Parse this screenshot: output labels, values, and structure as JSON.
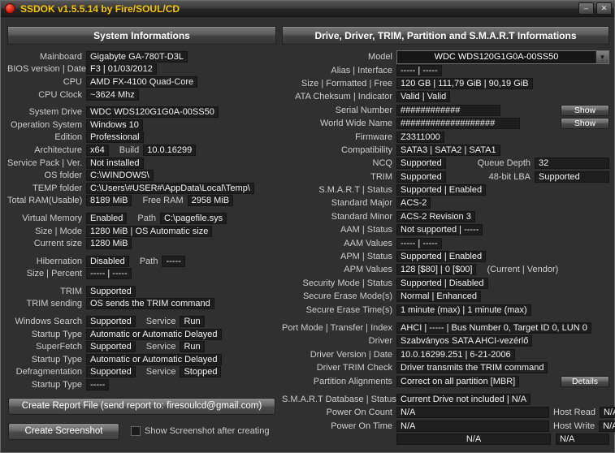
{
  "window": {
    "title": "SSDOK v1.5.5.14 by Fire/SOUL/CD",
    "minimize_icon": "–",
    "close_icon": "✕"
  },
  "left": {
    "header": "System Informations",
    "rows": [
      {
        "label": "Mainboard",
        "value": "Gigabyte GA-780T-D3L"
      },
      {
        "label": "BIOS version | Date",
        "value": "F3  |  01/03/2012"
      },
      {
        "label": "CPU",
        "value": "AMD FX-4100 Quad-Core"
      },
      {
        "label": "CPU Clock",
        "value": "~3624 Mhz"
      },
      {
        "label": "System Drive",
        "value": "WDC WDS120G1G0A-00SS50"
      },
      {
        "label": "Operation System",
        "value": "Windows 10"
      },
      {
        "label": "Edition",
        "value": "Professional"
      },
      {
        "label": "Architecture",
        "value": "x64",
        "label2": "Build",
        "value2": "10.0.16299"
      },
      {
        "label": "Service Pack | Ver.",
        "value": "Not installed"
      },
      {
        "label": "OS folder",
        "value": "C:\\WINDOWS\\"
      },
      {
        "label": "TEMP folder",
        "value": "C:\\Users\\#USER#\\AppData\\Local\\Temp\\"
      },
      {
        "label": "Total RAM(Usable)",
        "value": "8189 MiB",
        "label2": "Free RAM",
        "value2": "2958 MiB"
      },
      {
        "label": "Virtual Memory",
        "value": "Enabled",
        "label2": "Path",
        "value2": "C:\\pagefile.sys"
      },
      {
        "label": "Size | Mode",
        "value": "1280 MiB  |  OS Automatic size"
      },
      {
        "label": "Current size",
        "value": "1280 MiB"
      },
      {
        "label": "Hibernation",
        "value": "Disabled",
        "label2": "Path",
        "value2": "-----"
      },
      {
        "label": "Size | Percent",
        "value": "-----  |  -----"
      },
      {
        "label": "TRIM",
        "value": "Supported"
      },
      {
        "label": "TRIM sending",
        "value": "OS sends the TRIM command"
      },
      {
        "label": "Windows Search",
        "value": "Supported",
        "label2": "Service",
        "value2": "Run"
      },
      {
        "label": "Startup Type",
        "value": "Automatic or Automatic Delayed"
      },
      {
        "label": "SuperFetch",
        "value": "Supported",
        "label2": "Service",
        "value2": "Run"
      },
      {
        "label": "Startup Type",
        "value": "Automatic or Automatic Delayed"
      },
      {
        "label": "Defragmentation",
        "value": "Supported",
        "label2": "Service",
        "value2": "Stopped"
      },
      {
        "label": "Startup Type",
        "value": "-----"
      }
    ],
    "report_button": "Create Report File (send report to: firesoulcd@gmail.com)",
    "screenshot_button": "Create Screenshot",
    "screenshot_checkbox": "Show Screenshot after creating"
  },
  "right": {
    "header": "Drive, Driver, TRIM, Partition and S.M.A.R.T Informations",
    "rows": [
      {
        "label": "Model",
        "value": "WDC WDS120G1G0A-00SS50"
      },
      {
        "label": "Alias | Interface",
        "value": "-----  |  -----"
      },
      {
        "label": "Size | Formatted | Free",
        "value": "120 GB  |  111,79 GiB  |  90,19 GiB"
      },
      {
        "label": "ATA Cheksum | Indicator",
        "value": "Valid  |  Valid"
      },
      {
        "label": "Serial Number",
        "value": "############",
        "button": "Show"
      },
      {
        "label": "World Wide Name",
        "value": "###################",
        "button": "Show"
      },
      {
        "label": "Firmware",
        "value": "Z3311000"
      },
      {
        "label": "Compatibility",
        "value": "SATA3 | SATA2 | SATA1"
      },
      {
        "label": "NCQ",
        "value": "Supported",
        "label2": "Queue Depth",
        "value2": "32"
      },
      {
        "label": "TRIM",
        "value": "Supported",
        "label2": "48-bit LBA",
        "value2": "Supported"
      },
      {
        "label": "S.M.A.R.T | Status",
        "value": "Supported  |  Enabled"
      },
      {
        "label": "Standard Major",
        "value": "ACS-2"
      },
      {
        "label": "Standard Minor",
        "value": "ACS-2 Revision 3"
      },
      {
        "label": "AAM | Status",
        "value": "Not supported  |  -----"
      },
      {
        "label": "AAM Values",
        "value": "-----  |  -----"
      },
      {
        "label": "APM | Status",
        "value": "Supported  |  Enabled"
      },
      {
        "label": "APM Values",
        "value": "128 [$80]  |  0 [$00]",
        "label2": "(Current  |  Vendor)"
      },
      {
        "label": "Security Mode | Status",
        "value": "Supported  |  Disabled"
      },
      {
        "label": "Secure Erase Mode(s)",
        "value": "Normal  |  Enhanced"
      },
      {
        "label": "Secure Erase Time(s)",
        "value": "1 minute (max)  |  1 minute (max)"
      },
      {
        "label": "Port Mode | Transfer | Index",
        "value": "AHCI  |  -----  |  Bus Number 0, Target ID 0, LUN 0"
      },
      {
        "label": "Driver",
        "value": "Szabványos SATA AHCI-vezérlő"
      },
      {
        "label": "Driver Version | Date",
        "value": "10.0.16299.251  |  6-21-2006"
      },
      {
        "label": "Driver TRIM Check",
        "value": "Driver transmits the TRIM command"
      },
      {
        "label": "Partition Alignments",
        "value": "Correct on all partition [MBR]",
        "button": "Details"
      },
      {
        "label": "S.M.A.R.T Database | Status",
        "value": "Current Drive not included  |  N/A"
      },
      {
        "label": "Power On Count",
        "value": "N/A",
        "label2": "Host Read",
        "value2": "N/A"
      },
      {
        "label": "Power On Time",
        "value": "N/A",
        "label2": "Host Write",
        "value2": "N/A"
      },
      {
        "label": "",
        "value": "N/A",
        "value2": "N/A"
      }
    ]
  }
}
